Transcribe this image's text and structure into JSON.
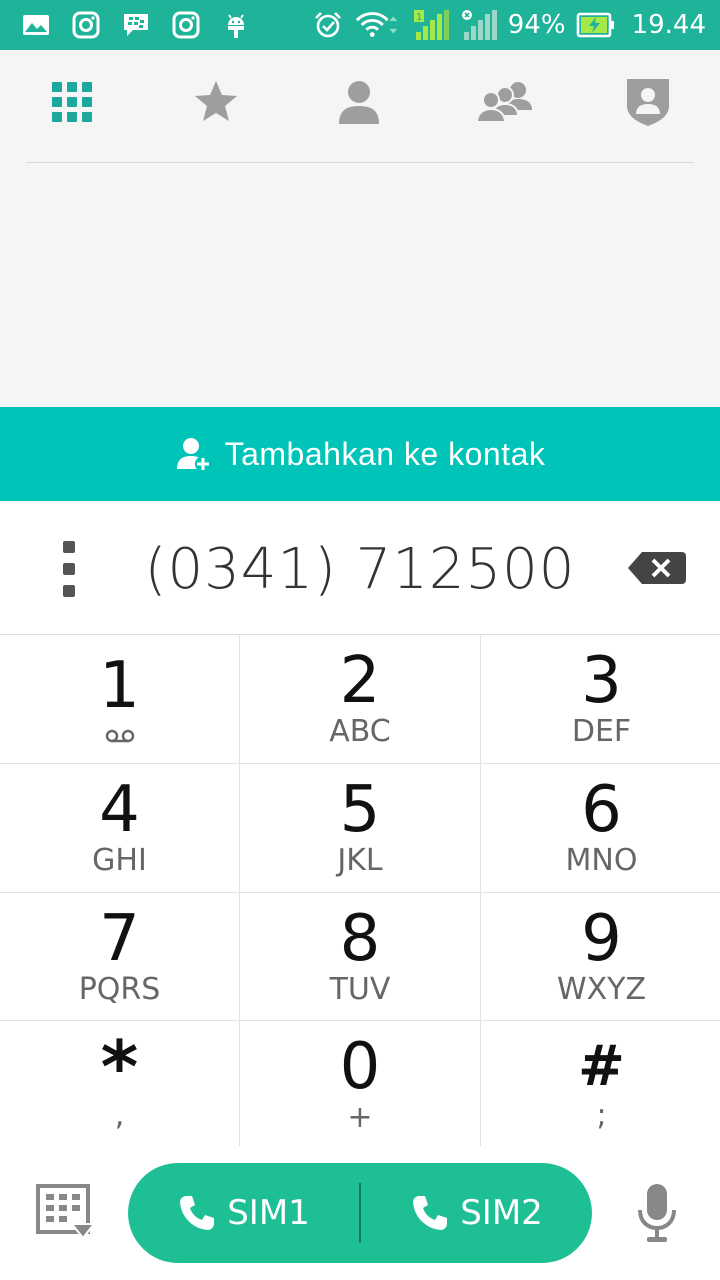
{
  "status_bar": {
    "left_icons": [
      "gallery-icon",
      "instagram-icon",
      "bbm-icon",
      "instagram-icon",
      "android-icon"
    ],
    "right_icons": [
      "alarm-icon",
      "wifi-icon",
      "sim1-signal-icon",
      "sim2-signal-icon",
      "battery-charging-icon"
    ],
    "battery": "94%",
    "time": "19.44"
  },
  "tabs": [
    {
      "icon": "dialpad-grid-icon",
      "active": true
    },
    {
      "icon": "star-icon",
      "active": false
    },
    {
      "icon": "contact-person-icon",
      "active": false
    },
    {
      "icon": "group-icon",
      "active": false
    },
    {
      "icon": "shield-person-icon",
      "active": false
    }
  ],
  "add_contact": {
    "label": "Tambahkan ke kontak",
    "icon": "add-person-icon"
  },
  "dialer": {
    "number": "(0341) 712500",
    "menu_icon": "more-vert-icon",
    "backspace_icon": "backspace-icon"
  },
  "keypad": {
    "keys": [
      {
        "digit": "1",
        "sub": ""
      },
      {
        "digit": "2",
        "sub": "ABC"
      },
      {
        "digit": "3",
        "sub": "DEF"
      },
      {
        "digit": "4",
        "sub": "GHI"
      },
      {
        "digit": "5",
        "sub": "JKL"
      },
      {
        "digit": "6",
        "sub": "MNO"
      },
      {
        "digit": "7",
        "sub": "PQRS"
      },
      {
        "digit": "8",
        "sub": "TUV"
      },
      {
        "digit": "9",
        "sub": "WXYZ"
      },
      {
        "digit": "*",
        "sub": ","
      },
      {
        "digit": "0",
        "sub": "+"
      },
      {
        "digit": "#",
        "sub": ";"
      }
    ]
  },
  "bottom": {
    "sim1_label": "SIM1",
    "sim2_label": "SIM2",
    "dialpad_icon": "dialpad-toggle-icon",
    "mic_icon": "microphone-icon"
  },
  "colors": {
    "status_bar": "#1fb39a",
    "accent": "#00c4b8",
    "call_button": "#1fbf96",
    "active_tab": "#1aa99c",
    "inactive_tab": "#9e9e9e"
  }
}
